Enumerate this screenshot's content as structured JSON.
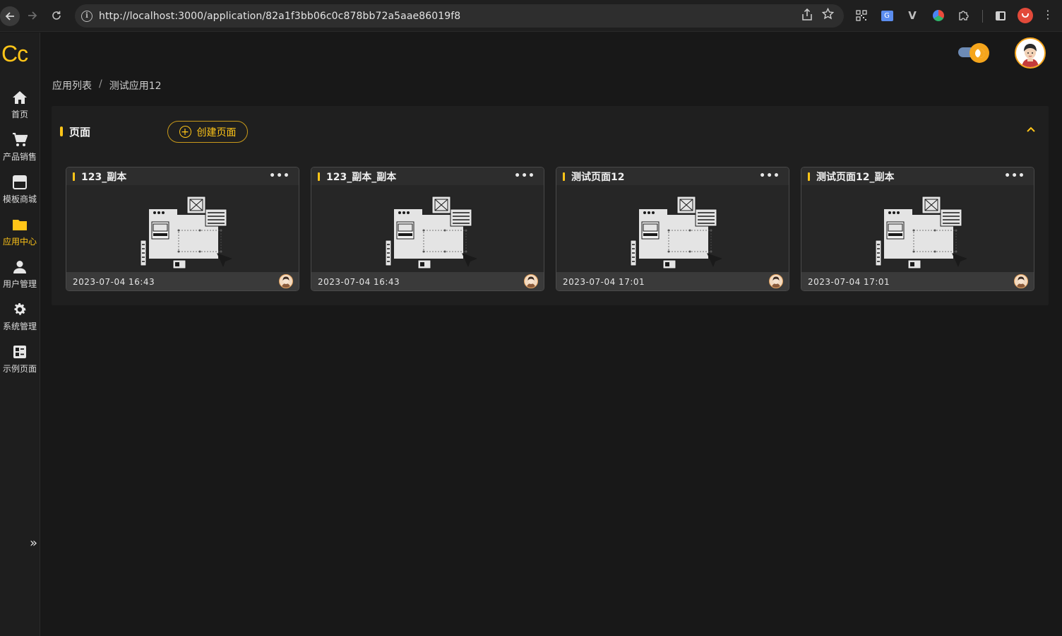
{
  "browser": {
    "url": "http://localhost:3000/application/82a1f3bb06c0c878bb72a5aae86019f8"
  },
  "app": {
    "logo": "Cc"
  },
  "sidebar": {
    "items": [
      {
        "label": "首页",
        "icon": "home-icon"
      },
      {
        "label": "产品销售",
        "icon": "cart-icon"
      },
      {
        "label": "模板商城",
        "icon": "store-icon"
      },
      {
        "label": "应用中心",
        "icon": "folder-icon",
        "active": true
      },
      {
        "label": "用户管理",
        "icon": "user-icon"
      },
      {
        "label": "系统管理",
        "icon": "gear-icon"
      },
      {
        "label": "示例页面",
        "icon": "dashboard-icon"
      }
    ],
    "collapse_glyph": "»"
  },
  "breadcrumb": {
    "items": [
      "应用列表",
      "测试应用12"
    ],
    "separator": "/"
  },
  "panel": {
    "title": "页面",
    "create_label": "创建页面",
    "collapse_glyph": "^",
    "cards": [
      {
        "title": "123_副本",
        "date": "2023-07-04 16:43"
      },
      {
        "title": "123_副本_副本",
        "date": "2023-07-04 16:43"
      },
      {
        "title": "测试页面12",
        "date": "2023-07-04 17:01"
      },
      {
        "title": "测试页面12_副本",
        "date": "2023-07-04 17:01"
      }
    ],
    "more_glyph": "•••"
  },
  "colors": {
    "accent": "#ffc518",
    "background": "#181818",
    "panel": "#1f1f1f"
  }
}
